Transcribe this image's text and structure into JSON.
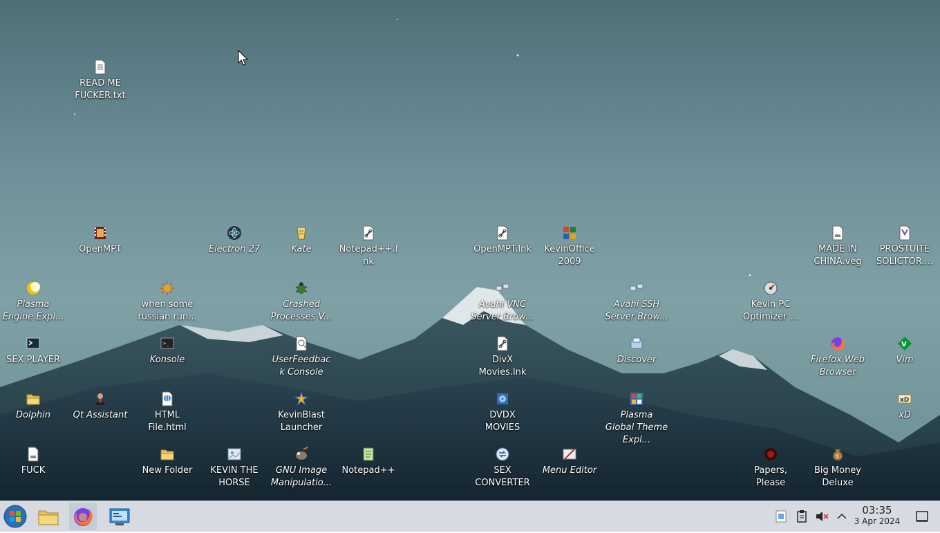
{
  "desktop": {
    "icons": [
      {
        "label": "READ ME FUCKER.txt",
        "italic": false,
        "icon": "text-file-icon"
      },
      {
        "label": "OpenMPT",
        "italic": false,
        "icon": "film-strip-icon"
      },
      {
        "label": "Electron 27",
        "italic": true,
        "icon": "electron-icon"
      },
      {
        "label": "Kate",
        "italic": true,
        "icon": "kate-icon"
      },
      {
        "label": "Notepad++.lnk",
        "italic": false,
        "icon": "link-file-icon"
      },
      {
        "label": "OpenMPT.lnk",
        "italic": false,
        "icon": "link-file-icon"
      },
      {
        "label": "KevinOffice 2009",
        "italic": false,
        "icon": "office-icon"
      },
      {
        "label": "MADE IN CHINA.veg",
        "italic": false,
        "icon": "media-file-icon"
      },
      {
        "label": "PROSTUITE SOLICTOR....",
        "italic": false,
        "icon": "vegas-file-icon"
      },
      {
        "label": "Plasma Engine Expl...",
        "italic": true,
        "icon": "plasma-engine-icon"
      },
      {
        "label": "when some russian run...",
        "italic": false,
        "icon": "sun-icon"
      },
      {
        "label": "Crashed Processes V...",
        "italic": true,
        "icon": "bug-icon"
      },
      {
        "label": "Avahi VNC Server Brow...",
        "italic": true,
        "icon": "network-icon"
      },
      {
        "label": "Avahi SSH Server Brow...",
        "italic": true,
        "icon": "network-icon"
      },
      {
        "label": "Kevin PC Optimizer ...",
        "italic": false,
        "icon": "optimizer-icon"
      },
      {
        "label": "SEX PLAYER",
        "italic": false,
        "icon": "terminal-icon"
      },
      {
        "label": "Konsole",
        "italic": true,
        "icon": "konsole-icon"
      },
      {
        "label": "UserFeedback Console",
        "italic": true,
        "icon": "feedback-icon"
      },
      {
        "label": "DivX Movies.lnk",
        "italic": false,
        "icon": "link-file-icon"
      },
      {
        "label": "Discover",
        "italic": true,
        "icon": "discover-icon"
      },
      {
        "label": "Firefox Web Browser",
        "italic": true,
        "icon": "firefox-icon"
      },
      {
        "label": "Vim",
        "italic": true,
        "icon": "vim-icon"
      },
      {
        "label": "Dolphin",
        "italic": true,
        "icon": "folder-icon"
      },
      {
        "label": "Qt Assistant",
        "italic": true,
        "icon": "assistant-icon"
      },
      {
        "label": "HTML File.html",
        "italic": false,
        "icon": "html-file-icon"
      },
      {
        "label": "KevinBlast Launcher",
        "italic": false,
        "icon": "blast-icon"
      },
      {
        "label": "DVDX MOVIES",
        "italic": false,
        "icon": "dvd-icon"
      },
      {
        "label": "Plasma Global Theme Expl...",
        "italic": true,
        "icon": "theme-icon"
      },
      {
        "label": "xD",
        "italic": true,
        "icon": "xd-icon"
      },
      {
        "label": "FUCK",
        "italic": false,
        "icon": "media-file-icon"
      },
      {
        "label": "New Folder",
        "italic": false,
        "icon": "folder-icon"
      },
      {
        "label": "KEVIN THE HORSE",
        "italic": false,
        "icon": "image-icon"
      },
      {
        "label": "GNU Image Manipulatio...",
        "italic": true,
        "icon": "gimp-icon"
      },
      {
        "label": "Notepad++",
        "italic": false,
        "icon": "notepad-icon"
      },
      {
        "label": "SEX CONVERTER",
        "italic": false,
        "icon": "converter-icon"
      },
      {
        "label": "Menu Editor",
        "italic": true,
        "icon": "menu-editor-icon"
      },
      {
        "label": "Papers, Please",
        "italic": false,
        "icon": "papers-please-icon"
      },
      {
        "label": "Big Money Deluxe",
        "italic": false,
        "icon": "money-bag-icon"
      }
    ]
  },
  "taskbar": {
    "start": {
      "icon": "start-orb-icon"
    },
    "pinned": [
      {
        "icon": "file-manager-icon"
      },
      {
        "icon": "firefox-icon"
      },
      {
        "icon": "system-settings-icon"
      }
    ],
    "tray": [
      {
        "icon": "network-tray-icon"
      },
      {
        "icon": "clipboard-icon"
      },
      {
        "icon": "muted-speaker-icon"
      },
      {
        "icon": "chevron-up-icon"
      }
    ],
    "clock": {
      "time": "03:35",
      "date": "3 Apr 2024"
    },
    "show_desktop": {
      "icon": "show-desktop-icon"
    }
  }
}
